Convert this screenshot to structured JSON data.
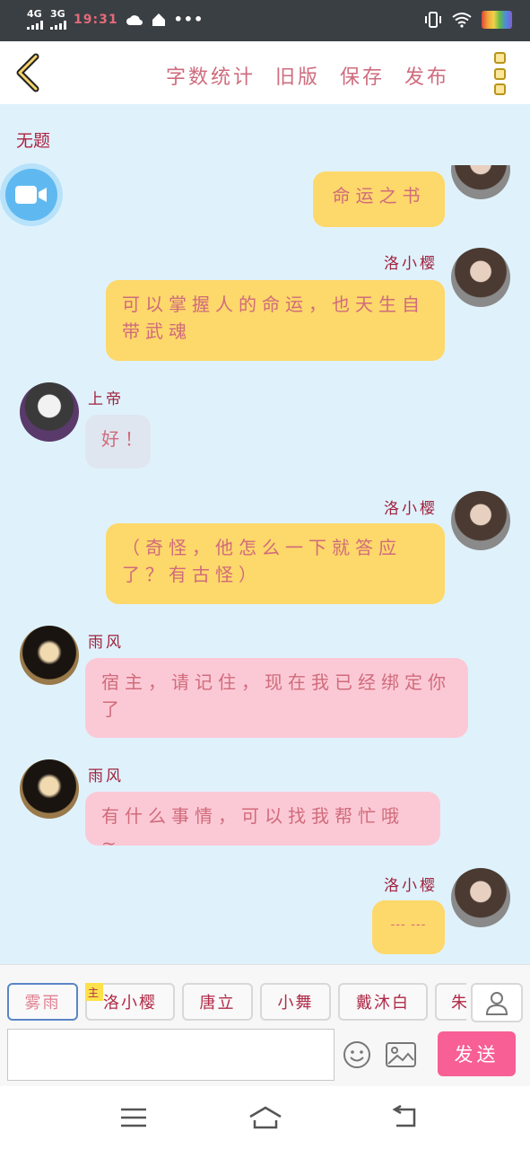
{
  "status_bar": {
    "network_1": "4G",
    "network_2": "3G",
    "time": "19:31",
    "icons": [
      "signal-icon",
      "cloud-icon",
      "home-icon",
      "more-dots-icon",
      "vibrate-icon",
      "wifi-icon",
      "battery-icon"
    ]
  },
  "header": {
    "actions": [
      "字数统计",
      "旧版",
      "保存",
      "发布"
    ],
    "back_icon": "chevron-left-icon",
    "more_icon": "more-vertical-icon"
  },
  "chat": {
    "title": "无题",
    "messages": [
      {
        "side": "right",
        "sender": "",
        "text": "命运之书",
        "color": "yellow"
      },
      {
        "side": "right",
        "sender": "洛小樱",
        "text": "可以掌握人的命运，也天生自带武魂",
        "color": "yellow"
      },
      {
        "side": "left",
        "sender": "上帝",
        "text": "好！",
        "color": "gray"
      },
      {
        "side": "right",
        "sender": "洛小樱",
        "text": "（奇怪，他怎么一下就答应了？有古怪）",
        "color": "yellow"
      },
      {
        "side": "left",
        "sender": "雨风",
        "text": "宿主，请记住，现在我已经绑定你了",
        "color": "pink"
      },
      {
        "side": "left",
        "sender": "雨风",
        "text": "有什么事情，可以找我帮忙哦~",
        "color": "pink"
      },
      {
        "side": "right",
        "sender": "洛小樱",
        "text": "--- ---",
        "color": "yellow"
      }
    ]
  },
  "input": {
    "characters": [
      "雾雨",
      "洛小樱",
      "唐立",
      "小舞",
      "戴沐白",
      "朱"
    ],
    "main_badge": "主",
    "placeholder": "",
    "send_label": "发送"
  },
  "colors": {
    "chat_bg": "#dff2fc",
    "bubble_yellow": "#fdd86a",
    "bubble_pink": "#fbc9d5",
    "bubble_gray": "#dfe6ef",
    "send_button": "#f75f95",
    "text_accent": "#d06b7c"
  }
}
